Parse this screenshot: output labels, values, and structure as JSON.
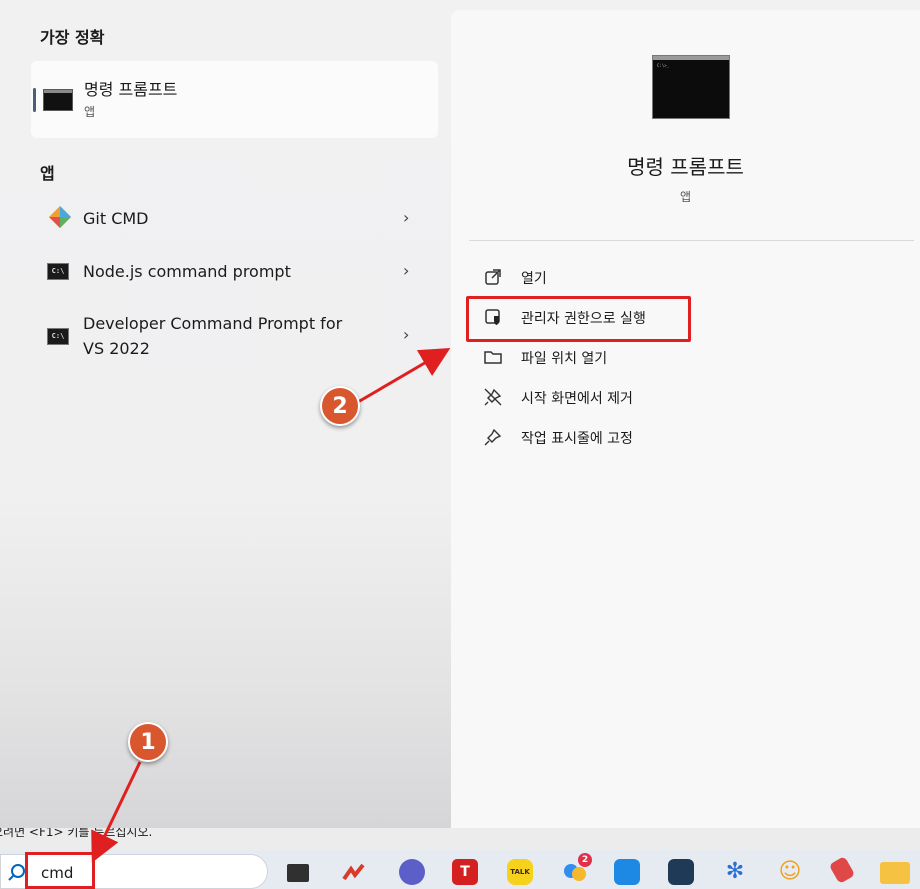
{
  "best_match": {
    "section_title": "가장 정확",
    "app_title": "명령 프롬프트",
    "app_type": "앱"
  },
  "apps": {
    "section_title": "앱",
    "items": [
      {
        "label": "Git CMD",
        "chevron": "›"
      },
      {
        "label": "Node.js command prompt",
        "chevron": "›"
      },
      {
        "label_line1": "Developer Command Prompt for",
        "label_line2": "VS 2022",
        "chevron": "›"
      }
    ]
  },
  "detail": {
    "title": "명령 프롬프트",
    "subtitle": "앱",
    "actions": [
      {
        "label": "열기",
        "icon": "open-external-icon"
      },
      {
        "label": "관리자 권한으로 실행",
        "icon": "shield-admin-icon"
      },
      {
        "label": "파일 위치 열기",
        "icon": "folder-icon"
      },
      {
        "label": "시작 화면에서 제거",
        "icon": "unpin-icon"
      },
      {
        "label": "작업 표시줄에 고정",
        "icon": "pin-icon"
      }
    ]
  },
  "annotations": {
    "step1": "1",
    "step2": "2",
    "highlight_color": "#e02020",
    "badge_color": "#d9572f"
  },
  "hint_text": "으려면 <F1> 키를 누르십시오.",
  "taskbar": {
    "search_value": "cmd",
    "apps": [
      {
        "name": "windows-icon"
      },
      {
        "name": "app-arrow-icon"
      },
      {
        "name": "chat-icon"
      },
      {
        "name": "t-app-icon",
        "label": "T"
      },
      {
        "name": "kakaotalk-icon",
        "label": "TALK"
      },
      {
        "name": "messenger-icon",
        "badge": "2"
      },
      {
        "name": "pay-icon"
      },
      {
        "name": "shield-app-icon"
      },
      {
        "name": "snowflake-icon"
      },
      {
        "name": "smile-icon"
      },
      {
        "name": "eraser-icon"
      },
      {
        "name": "file-explorer-icon"
      }
    ]
  }
}
